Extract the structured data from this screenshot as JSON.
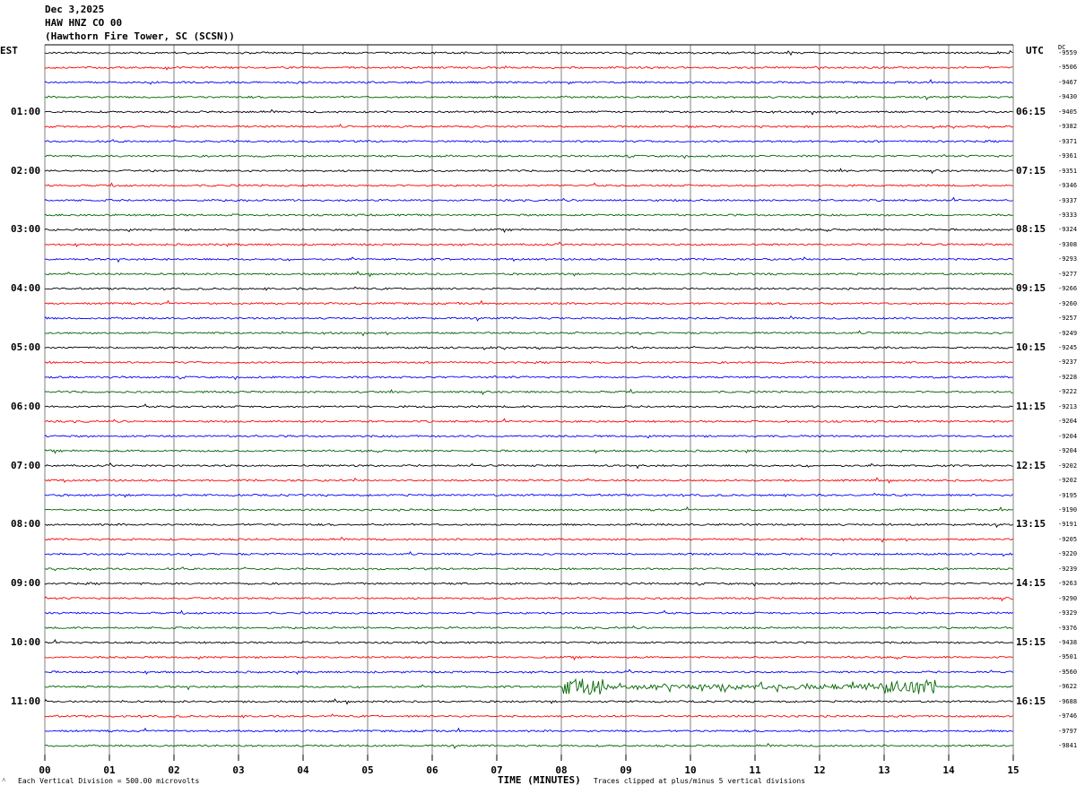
{
  "header": {
    "date": "Dec 3,2025",
    "station": "HAW HNZ CO 00",
    "location": "(Hawthorn Fire Tower, SC (SCSN))"
  },
  "left_tz": "EST",
  "right_tz": "UTC",
  "dc_label": "DC",
  "left_hour_labels": [
    "01:00",
    "02:00",
    "03:00",
    "04:00",
    "05:00",
    "06:00",
    "07:00",
    "08:00",
    "09:00",
    "10:00",
    "11:00"
  ],
  "right_hour_labels": [
    "06:15",
    "07:15",
    "08:15",
    "09:15",
    "10:15",
    "11:15",
    "12:15",
    "13:15",
    "14:15",
    "15:15",
    "16:15"
  ],
  "x_tick_labels": [
    "00",
    "01",
    "02",
    "03",
    "04",
    "05",
    "06",
    "07",
    "08",
    "09",
    "10",
    "11",
    "12",
    "13",
    "14",
    "15"
  ],
  "x_title": "TIME (MINUTES)",
  "footer_left": "Each Vertical Division =  500.00 microvolts",
  "footer_right": "Traces clipped at plus/minus 5 vertical divisions",
  "colors": {
    "trace_cycle": [
      "#000000",
      "#ff0000",
      "#0000ff",
      "#006400"
    ],
    "grid": "#808080"
  },
  "chart_data": {
    "type": "line",
    "x": {
      "label": "TIME (MINUTES)",
      "min": 0,
      "max": 15,
      "ticks": [
        0,
        1,
        2,
        3,
        4,
        5,
        6,
        7,
        8,
        9,
        10,
        11,
        12,
        13,
        14,
        15
      ]
    },
    "trace_dc_offsets": [
      "-9559",
      "-9506",
      "-9467",
      "-9430",
      "-9405",
      "-9382",
      "-9371",
      "-9361",
      "-9351",
      "-9346",
      "-9337",
      "-9333",
      "-9324",
      "-9308",
      "-9293",
      "-9277",
      "-9266",
      "-9260",
      "-9257",
      "-9249",
      "-9245",
      "-9237",
      "-9228",
      "-9222",
      "-9213",
      "-9204",
      "-9204",
      "-9204",
      "-9202",
      "-9202",
      "-9195",
      "-9190",
      "-9191",
      "-9205",
      "-9220",
      "-9239",
      "-9263",
      "-9290",
      "-9329",
      "-9376",
      "-9438",
      "-9501",
      "-9560",
      "-9622",
      "-9688",
      "-9746",
      "-9797",
      "-9841"
    ],
    "events": [
      {
        "trace": 43,
        "x_start_min": 8.0,
        "x_end_min": 13.8,
        "description": ""
      }
    ]
  }
}
